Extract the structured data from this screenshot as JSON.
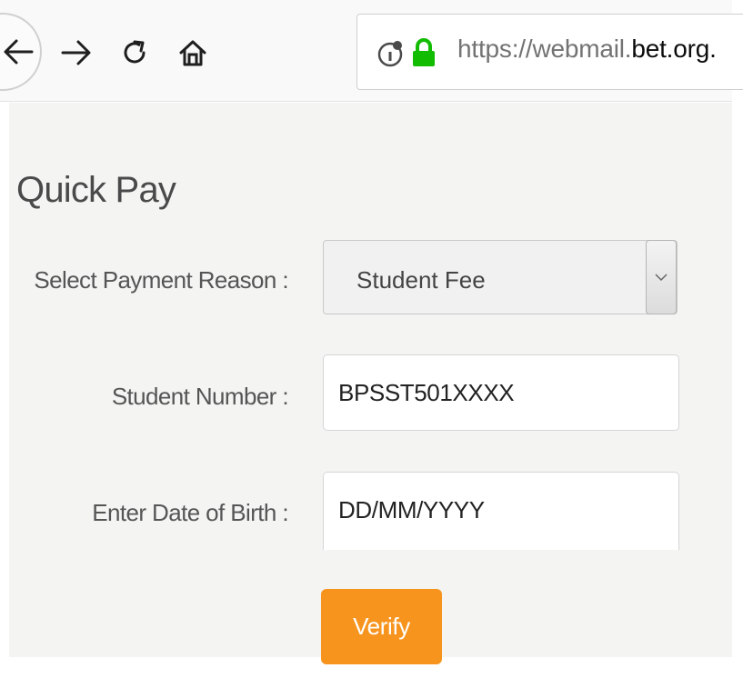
{
  "browser": {
    "url_prefix": "https://webmail.",
    "url_host": "bet.org.",
    "icons": [
      "back-arrow-icon",
      "forward-arrow-icon",
      "reload-icon",
      "home-icon",
      "info-icon",
      "lock-icon"
    ],
    "lock_color": "#12bc00"
  },
  "page": {
    "title": "Quick Pay",
    "background_color": "#f4f4f3"
  },
  "form": {
    "reason_label": "Select Payment Reason :",
    "reason_value": "Student Fee",
    "student_label": "Student Number :",
    "student_value": "BPSST501XXXX",
    "dob_label": "Enter Date of Birth :",
    "dob_value": "DD/MM/YYYY",
    "verify_label": "Verify",
    "verify_color": "#f7941d"
  }
}
